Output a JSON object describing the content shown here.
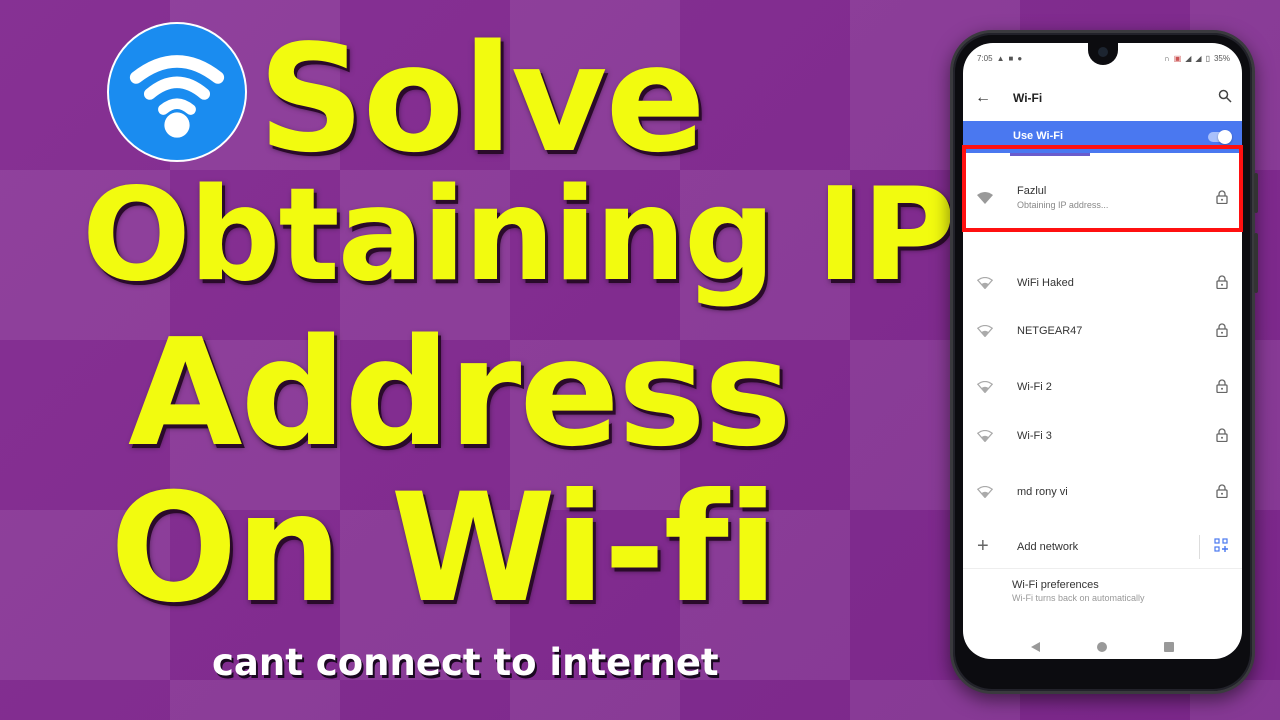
{
  "thumbnail": {
    "headline_lines": [
      "Solve",
      "Obtaining IP",
      "Address",
      "On Wi-fi"
    ],
    "subline": "cant connect to internet",
    "colors": {
      "headline": "#f2fb0f",
      "subline": "#ffffff",
      "background": "#7e2a8c",
      "logo_circle": "#1a8cf0",
      "highlight_box": "#ff1010"
    },
    "logo_icon": "wifi-icon"
  },
  "phone": {
    "status_bar": {
      "time": "7:05",
      "left_icons": [
        "warning-icon",
        "video-icon",
        "dot-icon"
      ],
      "right_icons": [
        "headset-icon",
        "cast-icon",
        "signal-icon",
        "signal-icon",
        "battery-icon"
      ],
      "battery": "35%"
    },
    "app_bar": {
      "back_icon": "arrow-left-icon",
      "title": "Wi-Fi",
      "search_icon": "search-icon"
    },
    "use_wifi": {
      "label": "Use Wi-Fi",
      "enabled": true,
      "accent": "#4a78f0"
    },
    "connecting_network": {
      "name": "Fazlul",
      "status": "Obtaining IP address...",
      "secured": true
    },
    "networks": [
      {
        "name": "WiFi Haked",
        "secured": true
      },
      {
        "name": "NETGEAR47",
        "secured": true
      },
      {
        "name": "Wi-Fi 2",
        "secured": true
      },
      {
        "name": "Wi-Fi 3",
        "secured": true
      },
      {
        "name": "md rony vi",
        "secured": true
      }
    ],
    "add_network": {
      "label": "Add network",
      "icon": "plus-icon",
      "qr_icon": "qr-scan-icon"
    },
    "preferences": {
      "title": "Wi-Fi preferences",
      "subtitle": "Wi-Fi turns back on automatically"
    },
    "nav_bar": [
      "back",
      "home",
      "recents"
    ]
  }
}
